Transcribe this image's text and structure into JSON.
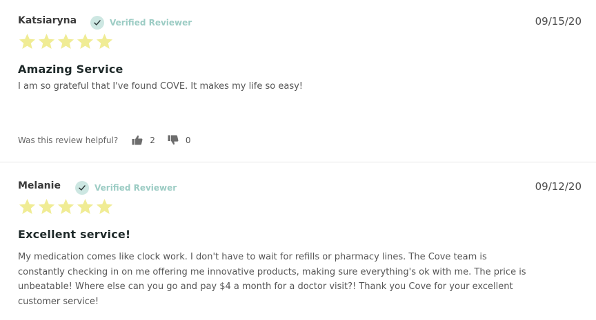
{
  "reviews": [
    {
      "name": "Katsiaryna",
      "verified_label": "Verified Reviewer",
      "date": "09/15/20",
      "rating": 5,
      "title": "Amazing Service",
      "body": "I am so grateful that I've found COVE. It makes my life so easy!",
      "helpful_prompt": "Was this review helpful?",
      "thumbs_up_count": "2",
      "thumbs_down_count": "0"
    },
    {
      "name": "Melanie",
      "verified_label": "Verified Reviewer",
      "date": "09/12/20",
      "rating": 5,
      "title": "Excellent service!",
      "body": "My medication comes like clock work. I don't have to wait for refills or pharmacy lines. The Cove team is constantly checking in on me offering me innovative products, making sure everything's ok with me. The price is unbeatable! Where else can you go and pay $4 a month for a doctor visit?! Thank you Cove for your excellent customer service!"
    }
  ],
  "colors": {
    "star": "#f0ec94",
    "verified_badge": "#cde7e2",
    "verified_text": "#9cccc4",
    "divider": "#e6e6e6"
  },
  "icons": {
    "verified": "check-icon",
    "star": "star-icon",
    "thumbs_up": "thumbs-up-icon",
    "thumbs_down": "thumbs-down-icon"
  }
}
